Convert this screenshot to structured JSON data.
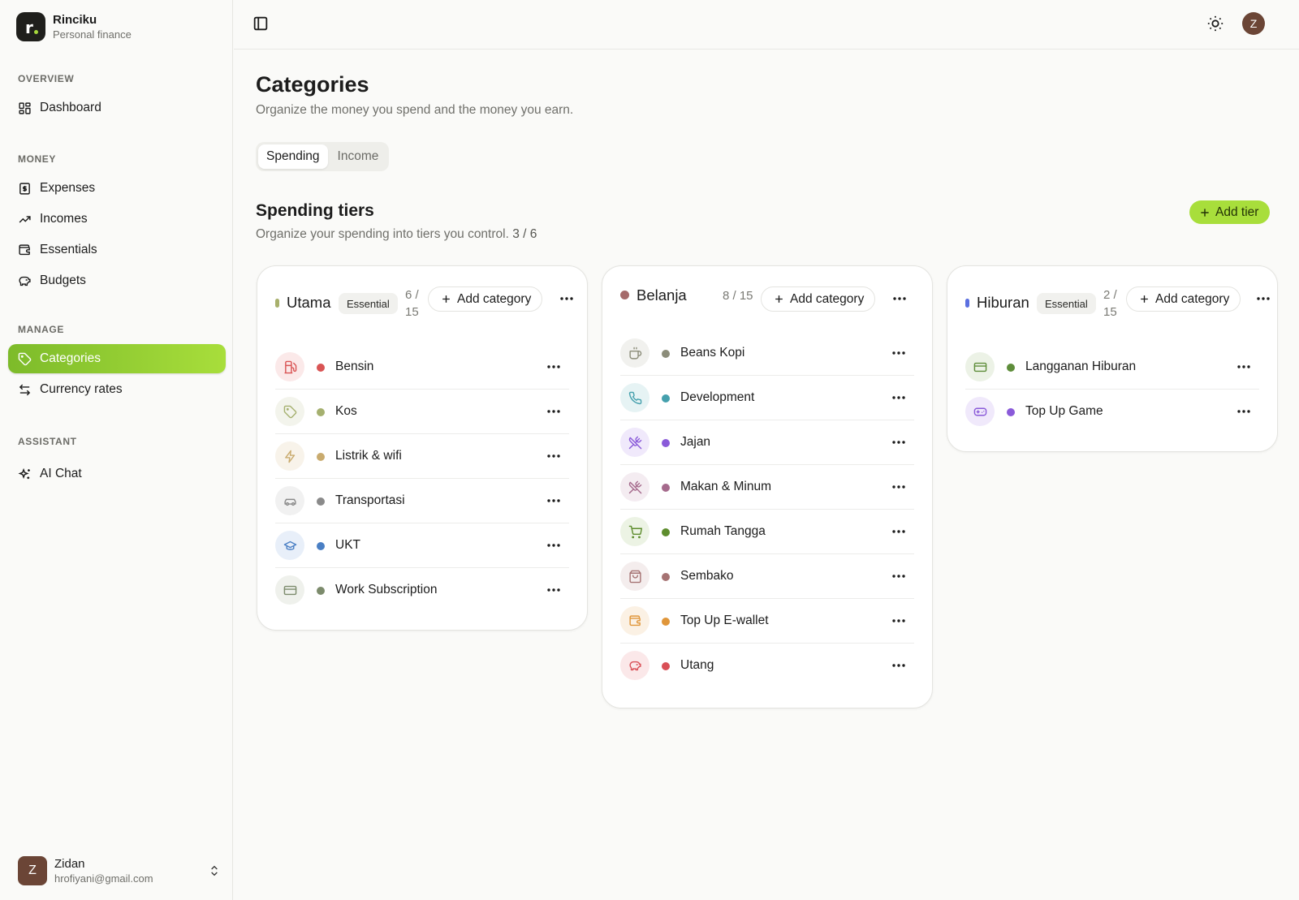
{
  "app": {
    "name": "Rinciku",
    "subtitle": "Personal finance"
  },
  "sidebar": {
    "sections": {
      "overview": "OVERVIEW",
      "money": "MONEY",
      "manage": "MANAGE",
      "assistant": "ASSISTANT"
    },
    "items": {
      "dashboard": "Dashboard",
      "expenses": "Expenses",
      "incomes": "Incomes",
      "essentials": "Essentials",
      "budgets": "Budgets",
      "categories": "Categories",
      "currency_rates": "Currency rates",
      "ai_chat": "AI Chat"
    },
    "active": "categories",
    "user": {
      "initial": "Z",
      "name": "Zidan",
      "email": "hrofiyani@gmail.com"
    }
  },
  "topbar": {
    "avatar_initial": "Z"
  },
  "page": {
    "title": "Categories",
    "subtitle": "Organize the money you spend and the money you earn.",
    "tabs": [
      "Spending",
      "Income"
    ],
    "active_tab": "Spending"
  },
  "tiers_section": {
    "title": "Spending tiers",
    "subtitle": "Organize your spending into tiers you control.",
    "count": "3 / 6",
    "add_tier_label": "Add tier",
    "add_category_label": "Add category"
  },
  "tiers": [
    {
      "name": "Utama",
      "badge": "Essential",
      "count_top": "6 /",
      "count_bottom": "15",
      "marker_color": "#a8b06c",
      "categories": [
        {
          "name": "Bensin",
          "icon": "fuel-icon",
          "color": "#d95454",
          "bg": "#fbe9e9"
        },
        {
          "name": "Kos",
          "icon": "tag-icon",
          "color": "#a5b06f",
          "bg": "#f3f4ec"
        },
        {
          "name": "Listrik & wifi",
          "icon": "zap-icon",
          "color": "#c9ab6e",
          "bg": "#f8f3ea"
        },
        {
          "name": "Transportasi",
          "icon": "car-icon",
          "color": "#8a8a8a",
          "bg": "#f1f1f1"
        },
        {
          "name": "UKT",
          "icon": "graduation-cap-icon",
          "color": "#4a7fc4",
          "bg": "#e8eff9"
        },
        {
          "name": "Work Subscription",
          "icon": "credit-card-icon",
          "color": "#7c8b6c",
          "bg": "#eff1ec"
        }
      ]
    },
    {
      "name": "Belanja",
      "badge": "",
      "count": "8 / 15",
      "marker_color": "#a56a6a",
      "categories": [
        {
          "name": "Beans Kopi",
          "icon": "coffee-icon",
          "color": "#8c8d7a",
          "bg": "#f1f1ee"
        },
        {
          "name": "Development",
          "icon": "phone-icon",
          "color": "#45a0ad",
          "bg": "#e6f3f4"
        },
        {
          "name": "Jajan",
          "icon": "utensils-crossed-icon",
          "color": "#8a5ad9",
          "bg": "#f0e9fb"
        },
        {
          "name": "Makan & Minum",
          "icon": "utensils-crossed-icon",
          "color": "#a56a8c",
          "bg": "#f4ecf1"
        },
        {
          "name": "Rumah Tangga",
          "icon": "shopping-cart-icon",
          "color": "#5e8d2e",
          "bg": "#ecf3e4"
        },
        {
          "name": "Sembako",
          "icon": "shopping-bag-icon",
          "color": "#a57272",
          "bg": "#f4eded"
        },
        {
          "name": "Top Up E-wallet",
          "icon": "wallet-icon",
          "color": "#e0963a",
          "bg": "#fbf1e4"
        },
        {
          "name": "Utang",
          "icon": "piggy-bank-icon",
          "color": "#d94f56",
          "bg": "#fbe8e9"
        }
      ]
    },
    {
      "name": "Hiburan",
      "badge": "Essential",
      "count_top": "2 /",
      "count_bottom": "15",
      "marker_color": "#5b6fe0",
      "categories": [
        {
          "name": "Langganan Hiburan",
          "icon": "credit-card-icon",
          "color": "#5e8d3a",
          "bg": "#ecf2e6"
        },
        {
          "name": "Top Up Game",
          "icon": "gamepad-icon",
          "color": "#8a5ad9",
          "bg": "#f0e9fb"
        }
      ]
    }
  ]
}
